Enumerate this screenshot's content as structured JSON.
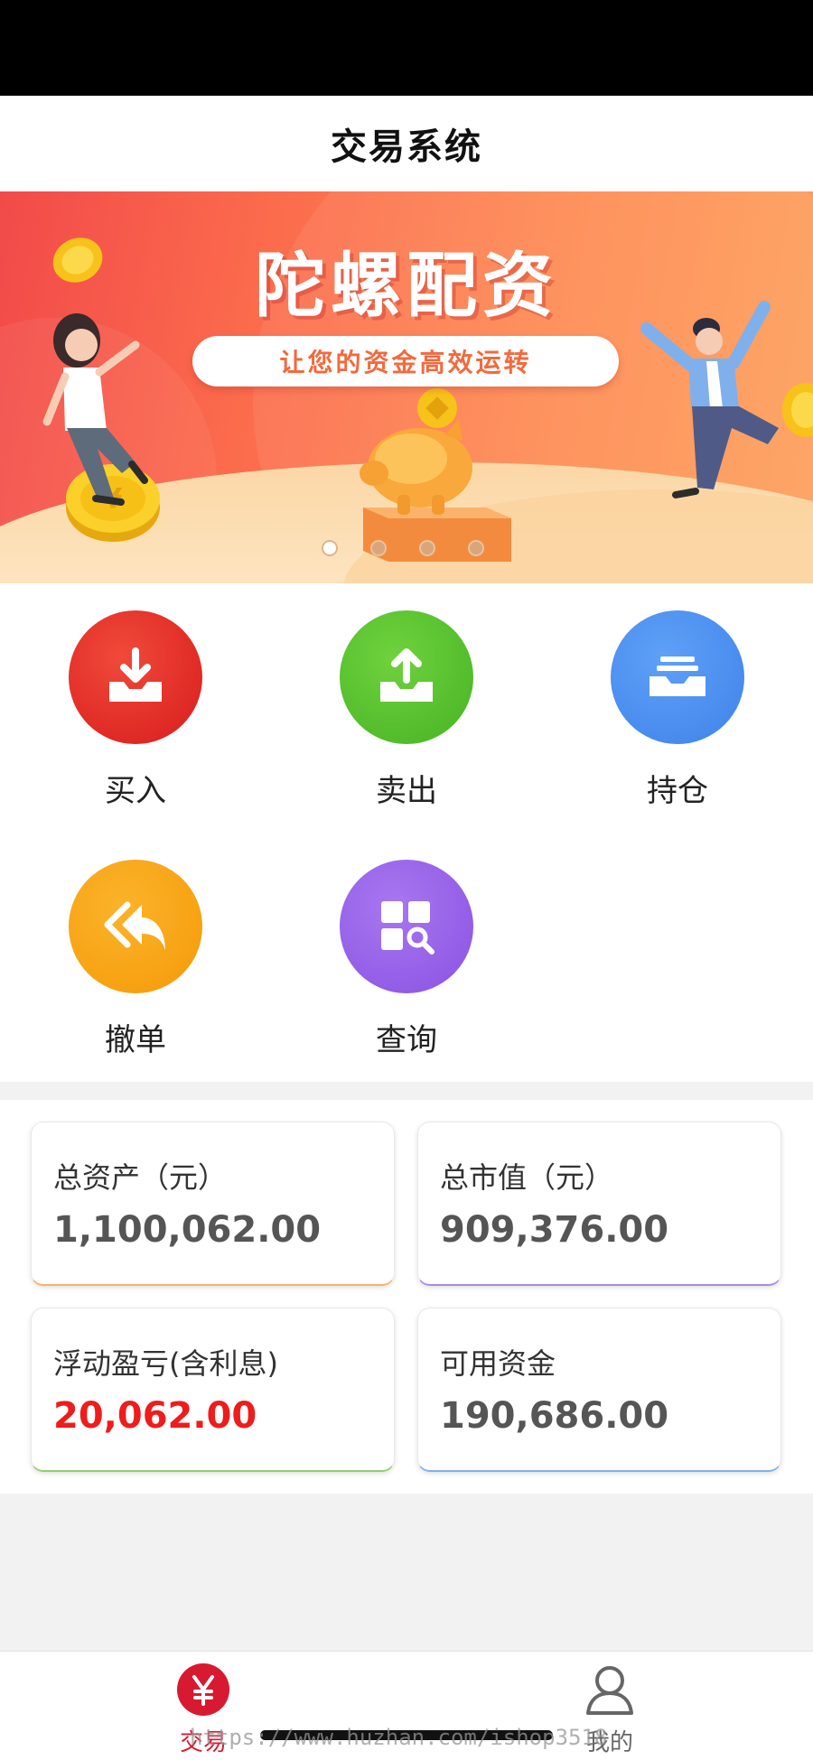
{
  "header": {
    "title": "交易系统"
  },
  "banner": {
    "headline": "陀螺配资",
    "tagline": "让您的资金高效运转",
    "slide_count": 4,
    "active_slide": 0
  },
  "actions": [
    {
      "label": "买入",
      "icon": "download-tray-icon",
      "color": "#e42626"
    },
    {
      "label": "卖出",
      "icon": "upload-tray-icon",
      "color": "#5ac42f"
    },
    {
      "label": "持仓",
      "icon": "inbox-stack-icon",
      "color": "#4c8ff0"
    },
    {
      "label": "撤单",
      "icon": "double-reply-icon",
      "color": "#f8a10f"
    },
    {
      "label": "查询",
      "icon": "grid-search-icon",
      "color": "#9b63e8"
    }
  ],
  "summary": {
    "total_assets": {
      "label": "总资产（元）",
      "value": "1,100,062.00"
    },
    "market_value": {
      "label": "总市值（元）",
      "value": "909,376.00"
    },
    "floating_pnl": {
      "label": "浮动盈亏(含利息)",
      "value": "20,062.00"
    },
    "available_funds": {
      "label": "可用资金",
      "value": "190,686.00"
    }
  },
  "tabbar": {
    "trade": {
      "label": "交易",
      "icon": "yen-icon",
      "active": true
    },
    "mine": {
      "label": "我的",
      "icon": "user-icon",
      "active": false
    }
  },
  "watermark": "https://www.huzhan.com/ishop3518",
  "colors": {
    "accent_red": "#d71a32",
    "pnl_red": "#ee1c1c",
    "card_border_orange": "#f7b26a",
    "card_border_purple": "#a98ae8",
    "card_border_green": "#8fd16a",
    "card_border_blue": "#7fb0ec"
  }
}
